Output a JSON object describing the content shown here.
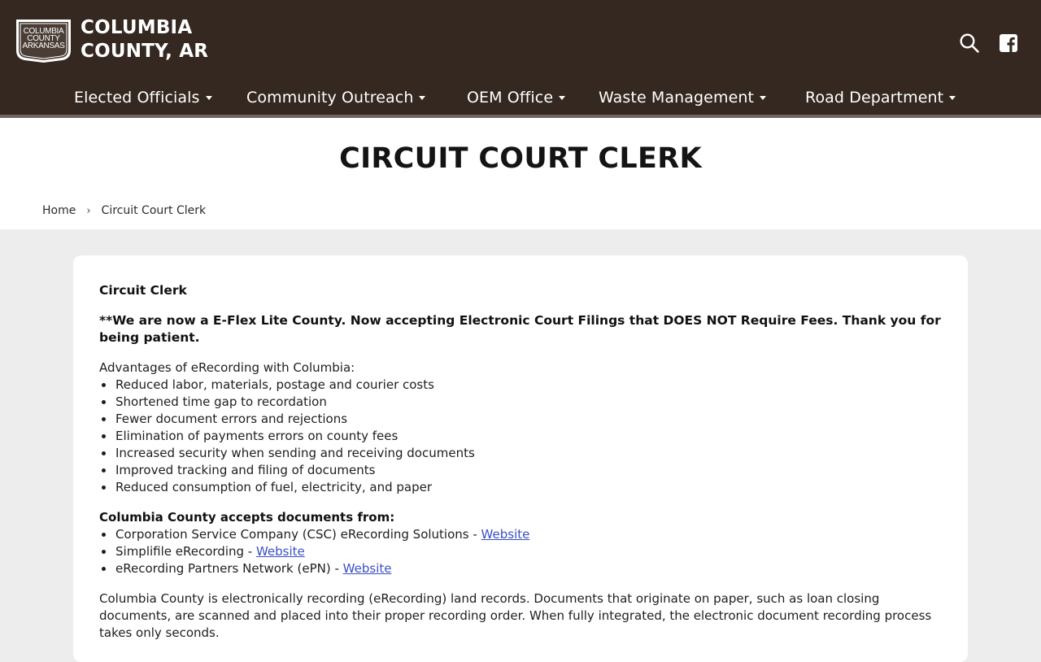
{
  "header": {
    "logo": {
      "line1": "COLUMBIA",
      "line2": "COUNTY",
      "line3": "ARKANSAS"
    },
    "site_title_line1": "COLUMBIA",
    "site_title_line2": "COUNTY, AR",
    "search_icon": "search-icon",
    "facebook_icon": "facebook-icon",
    "background_color": "#342820"
  },
  "nav": {
    "items": [
      {
        "label": "Elected Officials"
      },
      {
        "label": "Community Outreach"
      },
      {
        "label": "OEM Office"
      },
      {
        "label": "Waste Management"
      },
      {
        "label": "Road Department"
      }
    ]
  },
  "page": {
    "title": "CIRCUIT COURT CLERK",
    "breadcrumb": {
      "home": "Home",
      "separator": "›",
      "current": "Circuit Court Clerk"
    }
  },
  "content": {
    "heading": "Circuit Clerk",
    "notice": "**We are now a E-Flex Lite County. Now accepting Electronic Court Filings that DOES NOT Require Fees. Thank you for being patient.",
    "advantages_intro": "Advantages of eRecording with Columbia:",
    "advantages": [
      "Reduced labor, materials, postage and courier costs",
      "Shortened time gap to recordation",
      "Fewer document errors and rejections",
      "Elimination of payments errors on county fees",
      "Increased security when sending and receiving documents",
      "Improved tracking and filing of documents",
      "Reduced consumption of fuel, electricity, and paper"
    ],
    "accepts_heading": "Columbia County accepts documents from:",
    "providers": [
      {
        "name": "Corporation Service Company (CSC) eRecording Solutions - ",
        "link": "Website"
      },
      {
        "name": "Simplifile eRecording - ",
        "link": "Website"
      },
      {
        "name": "eRecording Partners Network (ePN) - ",
        "link": "Website"
      }
    ],
    "paragraph": "Columbia County is electronically recording (eRecording) land records. Documents that originate on paper, such as loan closing documents, are scanned and placed into their proper recording order. When fully integrated, the electronic document recording process takes only seconds."
  }
}
